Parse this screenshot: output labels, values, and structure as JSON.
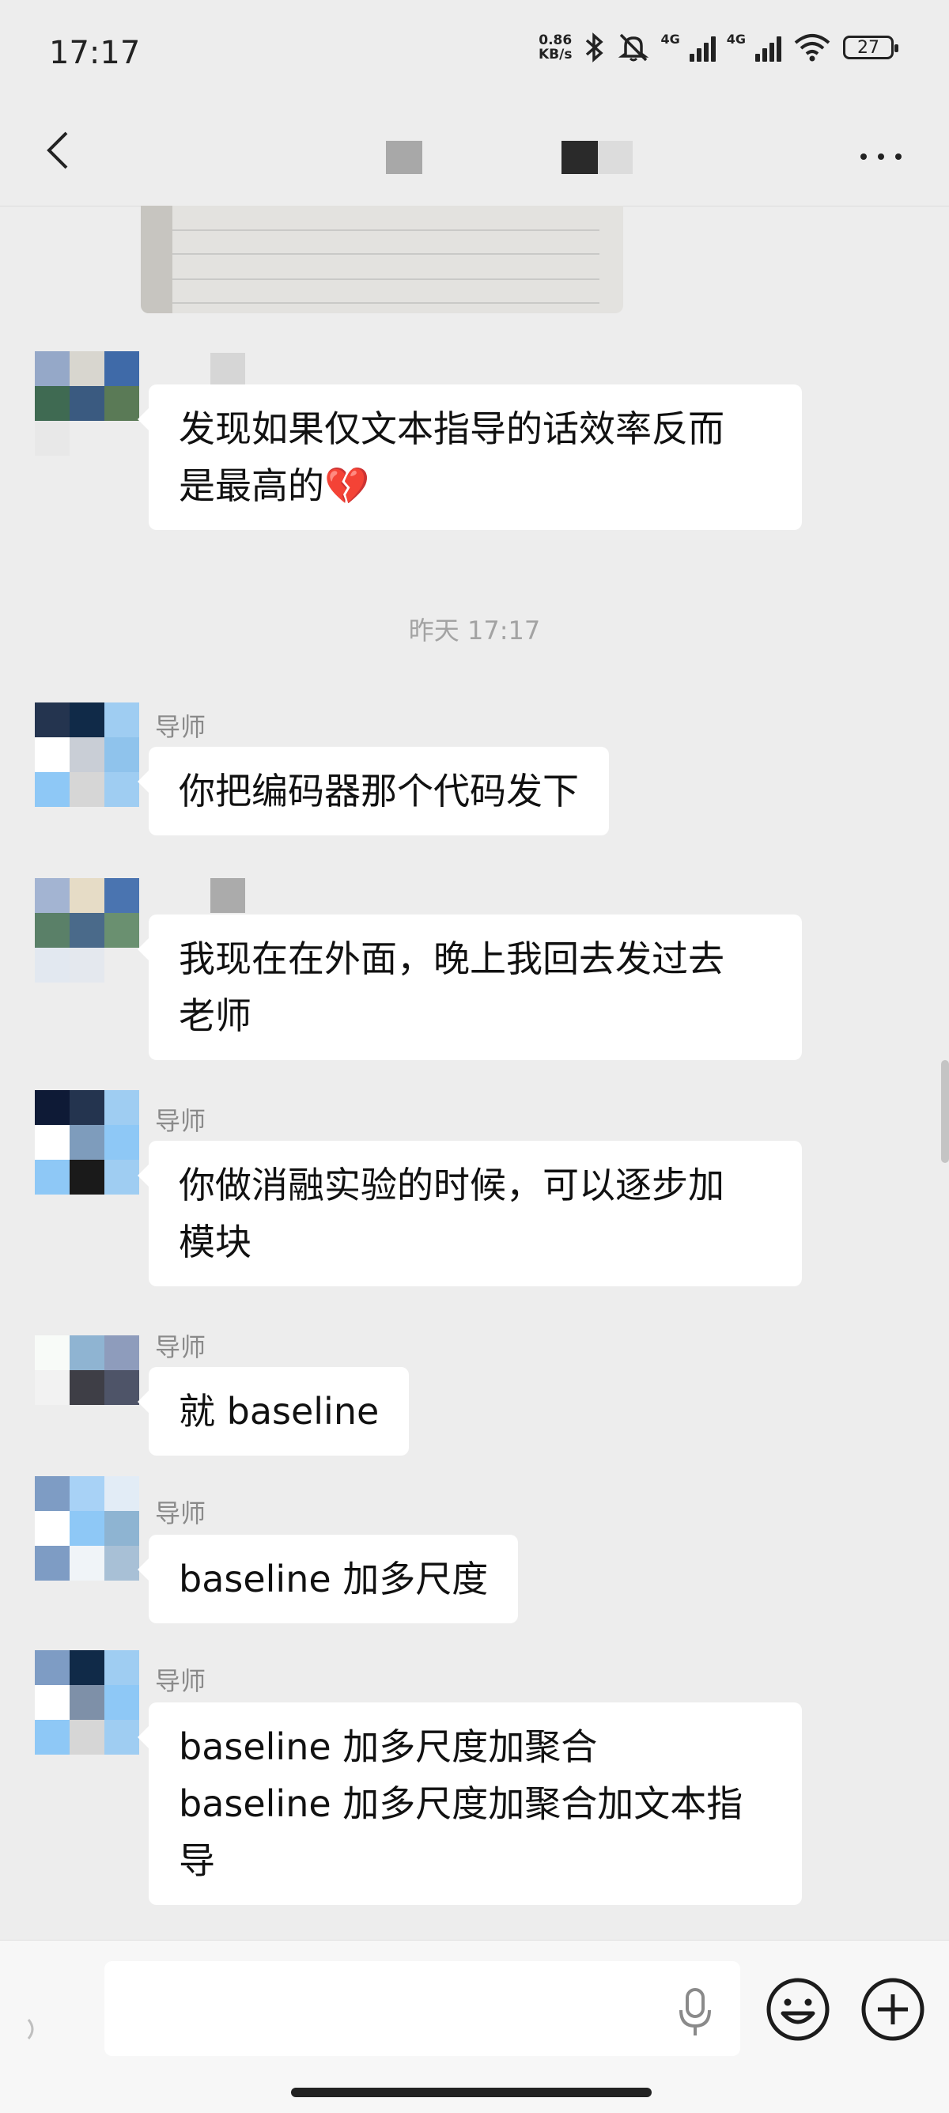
{
  "status_bar": {
    "time": "17:17",
    "net_speed_value": "0.86",
    "net_speed_unit": "KB/s",
    "signal_1_label": "4G",
    "signal_2_label": "4G",
    "battery": "27"
  },
  "nav": {
    "back_icon": "chevron-left-icon",
    "more_icon": "more-horizontal-icon",
    "more_label": "···"
  },
  "messages": [
    {
      "sender": "",
      "text_line1": "发现如果仅文本指导的话效率反而",
      "text_line2": "是最高的💔"
    },
    {
      "timestamp": "昨天 17:17"
    },
    {
      "sender": "导师",
      "text_line1": "你把编码器那个代码发下"
    },
    {
      "sender": "",
      "text_line1": "我现在在外面，晚上我回去发过去",
      "text_line2": "老师"
    },
    {
      "sender": "导师",
      "text_line1": "你做消融实验的时候，可以逐步加",
      "text_line2": "模块"
    },
    {
      "sender": "导师",
      "text_line1": "就 baseline"
    },
    {
      "sender": "导师",
      "text_line1": "baseline 加多尺度"
    },
    {
      "sender": "导师",
      "text_line1": "baseline 加多尺度加聚合",
      "text_line2": "baseline 加多尺度加聚合加文本指",
      "text_line3": "导"
    }
  ],
  "input_bar": {
    "placeholder": "",
    "voice_icon": "voice-toggle-icon",
    "mic_icon": "microphone-icon",
    "emoji_icon": "emoji-icon",
    "plus_icon": "plus-circle-icon"
  },
  "colors": {
    "background": "#ededed",
    "bubble": "#ffffff",
    "timestamp": "#a3a3a3",
    "sender_name": "#8a8a8a"
  }
}
